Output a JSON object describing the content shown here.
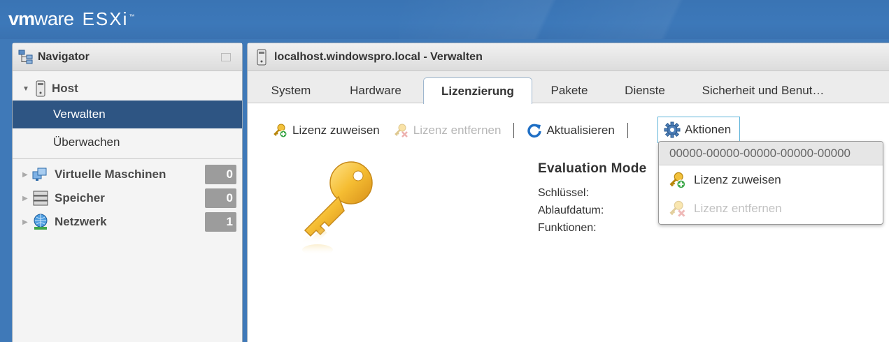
{
  "header": {
    "brand_vm": "vm",
    "brand_ware": "ware",
    "brand_product": "ESXi",
    "brand_tm": "™"
  },
  "navigator": {
    "title": "Navigator",
    "host": {
      "label": "Host",
      "icon": "server-icon"
    },
    "items": [
      {
        "label": "Verwalten",
        "selected": true
      },
      {
        "label": "Überwachen",
        "selected": false
      }
    ],
    "groups": [
      {
        "label": "Virtuelle Maschinen",
        "count": "0",
        "icon": "vm-icon"
      },
      {
        "label": "Speicher",
        "count": "0",
        "icon": "storage-icon"
      },
      {
        "label": "Netzwerk",
        "count": "1",
        "icon": "network-icon"
      }
    ]
  },
  "main": {
    "title": "localhost.windowspro.local - Verwalten",
    "tabs": [
      {
        "label": "System",
        "active": false
      },
      {
        "label": "Hardware",
        "active": false
      },
      {
        "label": "Lizenzierung",
        "active": true
      },
      {
        "label": "Pakete",
        "active": false
      },
      {
        "label": "Dienste",
        "active": false
      },
      {
        "label": "Sicherheit und Benut…",
        "active": false
      }
    ],
    "toolbar": {
      "assign_label": "Lizenz zuweisen",
      "remove_label": "Lizenz entfernen",
      "refresh_label": "Aktualisieren",
      "actions_label": "Aktionen"
    },
    "dropdown": {
      "key_value": "00000-00000-00000-00000-00000",
      "items": [
        {
          "label": "Lizenz zuweisen",
          "enabled": true
        },
        {
          "label": "Lizenz entfernen",
          "enabled": false
        }
      ]
    },
    "license": {
      "title": "Evaluation Mode",
      "fields": [
        "Schlüssel:",
        "Ablaufdatum:",
        "Funktionen:"
      ]
    }
  },
  "colors": {
    "header_blue": "#3a74b4",
    "selected_nav": "#2e5583",
    "aktionen_border": "#5fb4d9",
    "badge_gray": "#9c9c9c"
  }
}
